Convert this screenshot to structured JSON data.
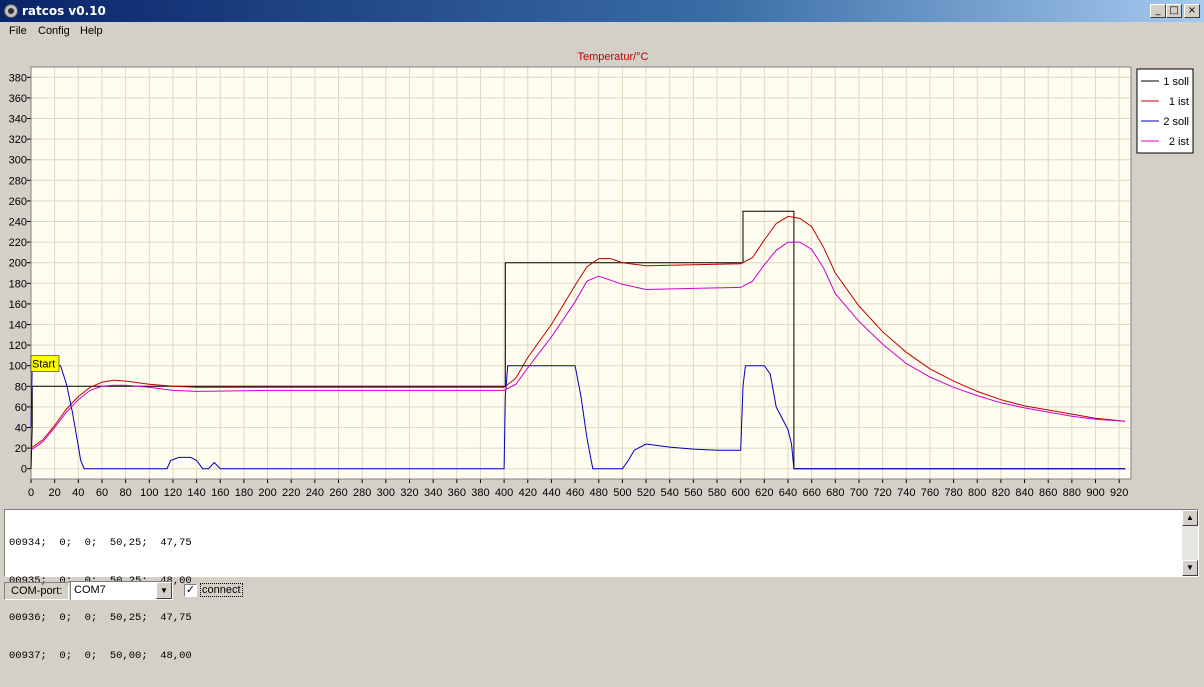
{
  "window": {
    "title": "ratcos v0.10",
    "controls": {
      "minimize": "_",
      "maximize": "□",
      "close": "×"
    }
  },
  "menu": {
    "items": [
      "File",
      "Config",
      "Help"
    ]
  },
  "chart_data": {
    "type": "line",
    "title": "Temperatur/°C",
    "xlim": [
      0,
      930
    ],
    "ylim": [
      -10,
      390
    ],
    "xticks": [
      0,
      20,
      40,
      60,
      80,
      100,
      120,
      140,
      160,
      180,
      200,
      220,
      240,
      260,
      280,
      300,
      320,
      340,
      360,
      380,
      400,
      420,
      440,
      460,
      480,
      500,
      520,
      540,
      560,
      580,
      600,
      620,
      640,
      660,
      680,
      700,
      720,
      740,
      760,
      780,
      800,
      820,
      840,
      860,
      880,
      900,
      920
    ],
    "yticks": [
      0,
      20,
      40,
      60,
      80,
      100,
      120,
      140,
      160,
      180,
      200,
      220,
      240,
      260,
      280,
      300,
      320,
      340,
      360,
      380
    ],
    "grid": true,
    "legend_position": "top-right",
    "annotation": {
      "text": "Start",
      "x": 0,
      "y": 102
    },
    "colors": {
      "plot_bg": "#fffcf0",
      "grid": "#e0d8c0",
      "annotation_bg": "#ffff00"
    },
    "series": [
      {
        "name": "1 soll",
        "color": "#000000",
        "x": [
          0,
          1,
          1,
          401,
          401,
          602,
          602,
          645,
          645,
          925
        ],
        "y": [
          0,
          40,
          80,
          80,
          200,
          200,
          250,
          250,
          0,
          0
        ]
      },
      {
        "name": "1 ist",
        "color": "#c00000",
        "x": [
          0,
          10,
          20,
          30,
          40,
          50,
          60,
          70,
          80,
          100,
          120,
          140,
          200,
          300,
          400,
          410,
          420,
          440,
          460,
          470,
          480,
          490,
          500,
          520,
          560,
          600,
          610,
          620,
          630,
          640,
          650,
          660,
          670,
          680,
          700,
          720,
          740,
          760,
          780,
          800,
          820,
          840,
          860,
          880,
          900,
          925
        ],
        "y": [
          20,
          28,
          42,
          58,
          70,
          79,
          84,
          86,
          85,
          82,
          80,
          79,
          79,
          79,
          79,
          88,
          108,
          140,
          178,
          196,
          204,
          204,
          200,
          197,
          198,
          199,
          205,
          222,
          238,
          245,
          243,
          235,
          215,
          190,
          158,
          133,
          113,
          97,
          85,
          75,
          67,
          61,
          57,
          53,
          49,
          46
        ]
      },
      {
        "name": "2 soll",
        "color": "#0000c0",
        "x": [
          0,
          1,
          5,
          25,
          30,
          35,
          40,
          42,
          45,
          115,
          118,
          125,
          135,
          140,
          142,
          145,
          150,
          155,
          160,
          400,
          401,
          403,
          405,
          460,
          465,
          470,
          475,
          500,
          505,
          510,
          520,
          540,
          560,
          580,
          600,
          602,
          604,
          620,
          625,
          630,
          640,
          643,
          645,
          925
        ],
        "y": [
          40,
          100,
          100,
          100,
          82,
          55,
          22,
          8,
          0,
          0,
          8,
          11,
          11,
          8,
          5,
          0,
          0,
          6,
          0,
          0,
          70,
          100,
          100,
          100,
          70,
          30,
          0,
          0,
          8,
          18,
          24,
          21,
          19,
          18,
          18,
          80,
          100,
          100,
          92,
          60,
          38,
          24,
          0,
          0
        ]
      },
      {
        "name": "2 ist",
        "color": "#d000d0",
        "x": [
          0,
          10,
          20,
          30,
          40,
          50,
          60,
          70,
          80,
          100,
          120,
          140,
          200,
          300,
          400,
          410,
          420,
          440,
          460,
          470,
          480,
          500,
          520,
          560,
          600,
          610,
          620,
          630,
          640,
          650,
          660,
          670,
          680,
          700,
          720,
          740,
          760,
          780,
          800,
          820,
          840,
          860,
          880,
          900,
          925
        ],
        "y": [
          18,
          26,
          40,
          55,
          67,
          76,
          80,
          81,
          81,
          79,
          76,
          75,
          76,
          76,
          76,
          82,
          98,
          128,
          162,
          182,
          187,
          179,
          174,
          175,
          176,
          182,
          198,
          212,
          220,
          220,
          213,
          195,
          170,
          143,
          121,
          102,
          89,
          79,
          71,
          64,
          59,
          55,
          51,
          48,
          46
        ]
      }
    ]
  },
  "log": {
    "lines": [
      "00934;  0;  0;  50,25;  47,75",
      "00935;  0;  0;  50,25;  48,00",
      "00936;  0;  0;  50,25;  47,75",
      "00937;  0;  0;  50,00;  48,00"
    ]
  },
  "bottom": {
    "com_label": "COM-port:",
    "com_value": "COM7",
    "connect_label": "connect",
    "connect_checked": "✓"
  }
}
